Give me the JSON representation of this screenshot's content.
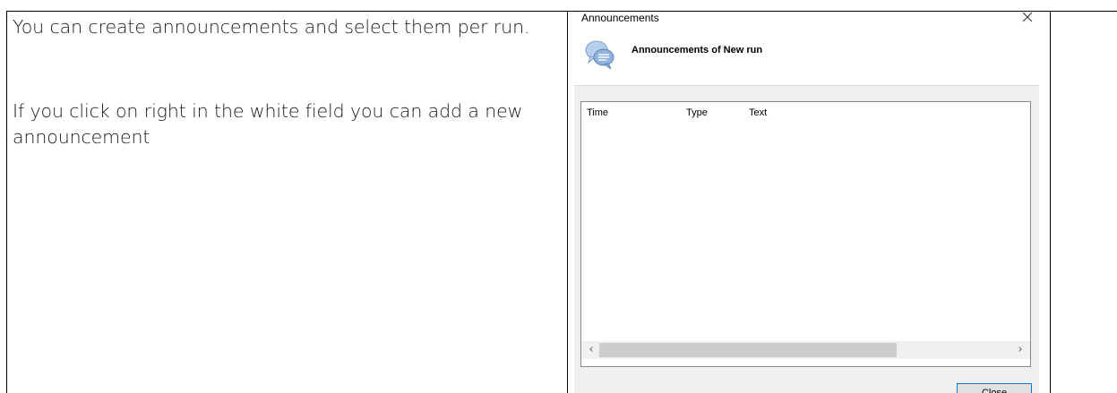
{
  "document": {
    "paragraphs": [
      "You can create announcements and select them per run.",
      "If you click on right in the white field you can add a new announcement"
    ]
  },
  "dialog": {
    "title": "Announcements",
    "close_icon": "close-icon",
    "header_icon": "speech-bubbles-icon",
    "header_title": "Announcements of New run",
    "list": {
      "columns": [
        "Time",
        "Type",
        "Text"
      ],
      "rows": []
    },
    "close_button_label": "Close"
  },
  "colors": {
    "dialog_background": "#f0f0f0",
    "list_background": "#ffffff",
    "button_border": "#0078d7",
    "icon_blue": "#8fb3dc"
  }
}
